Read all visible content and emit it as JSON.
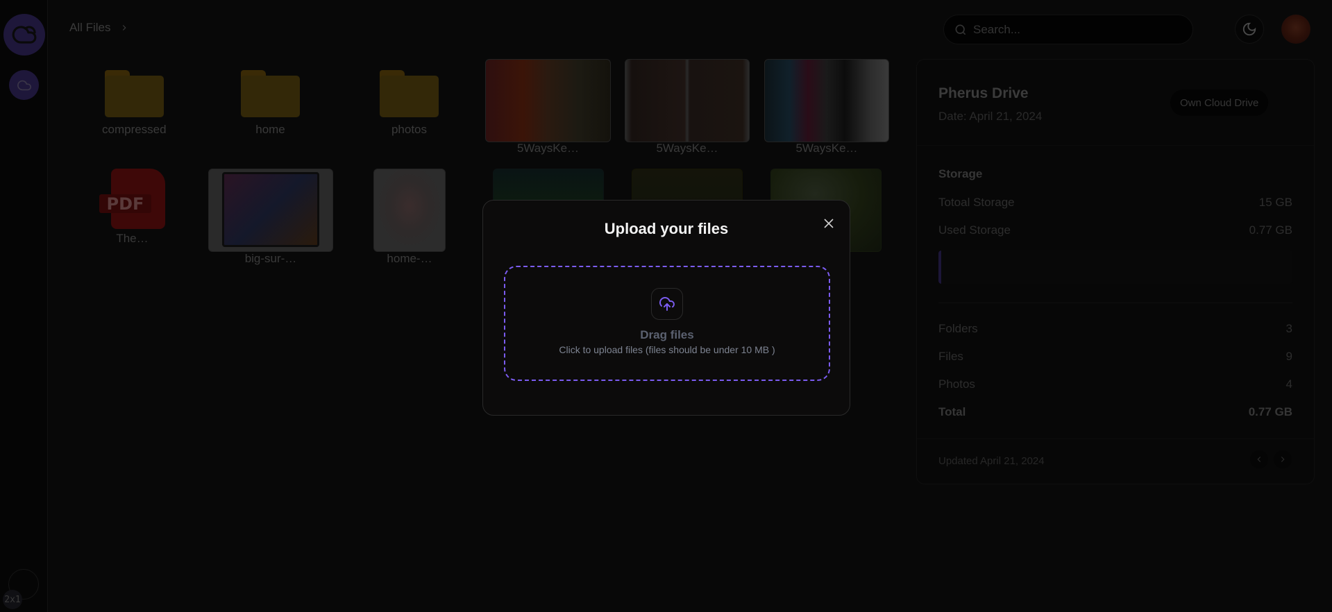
{
  "breadcrumb": {
    "root": "All Files"
  },
  "search": {
    "placeholder": "Search..."
  },
  "files": {
    "row1": [
      {
        "type": "folder",
        "name": "compressed"
      },
      {
        "type": "folder",
        "name": "home"
      },
      {
        "type": "folder",
        "name": "photos"
      },
      {
        "type": "image",
        "name": "5WaysKe…"
      },
      {
        "type": "image",
        "name": "5WaysKe…"
      },
      {
        "type": "image",
        "name": "5WaysKe…"
      }
    ],
    "row2": [
      {
        "type": "pdf",
        "name": "The…",
        "badge": "PDF"
      },
      {
        "type": "image",
        "name": "big-sur-…"
      },
      {
        "type": "image",
        "name": "home-…"
      },
      {
        "type": "image",
        "name": ""
      },
      {
        "type": "image",
        "name": ""
      },
      {
        "type": "image",
        "name": "…"
      }
    ]
  },
  "panel": {
    "title": "Pherus Drive",
    "date": "Date: April 21, 2024",
    "badge": "Own Cloud Drive",
    "storage_heading": "Storage",
    "total_label": "Totoal Storage",
    "total_value": "15 GB",
    "used_label": "Used Storage",
    "used_value": "0.77 GB",
    "used_fraction": 0.0513,
    "stats": [
      {
        "label": "Folders",
        "value": "3"
      },
      {
        "label": "Files",
        "value": "9"
      },
      {
        "label": "Photos",
        "value": "4"
      }
    ],
    "total_row": {
      "label": "Total",
      "value": "0.77 GB"
    },
    "updated": "Updated April 21, 2024"
  },
  "modal": {
    "title": "Upload your files",
    "drop_title": "Drag files",
    "drop_subtitle": "Click to upload files (files should be under 10 MB )",
    "accent": "#7b5cf0"
  },
  "misc": {
    "size_badge": "2x1"
  }
}
